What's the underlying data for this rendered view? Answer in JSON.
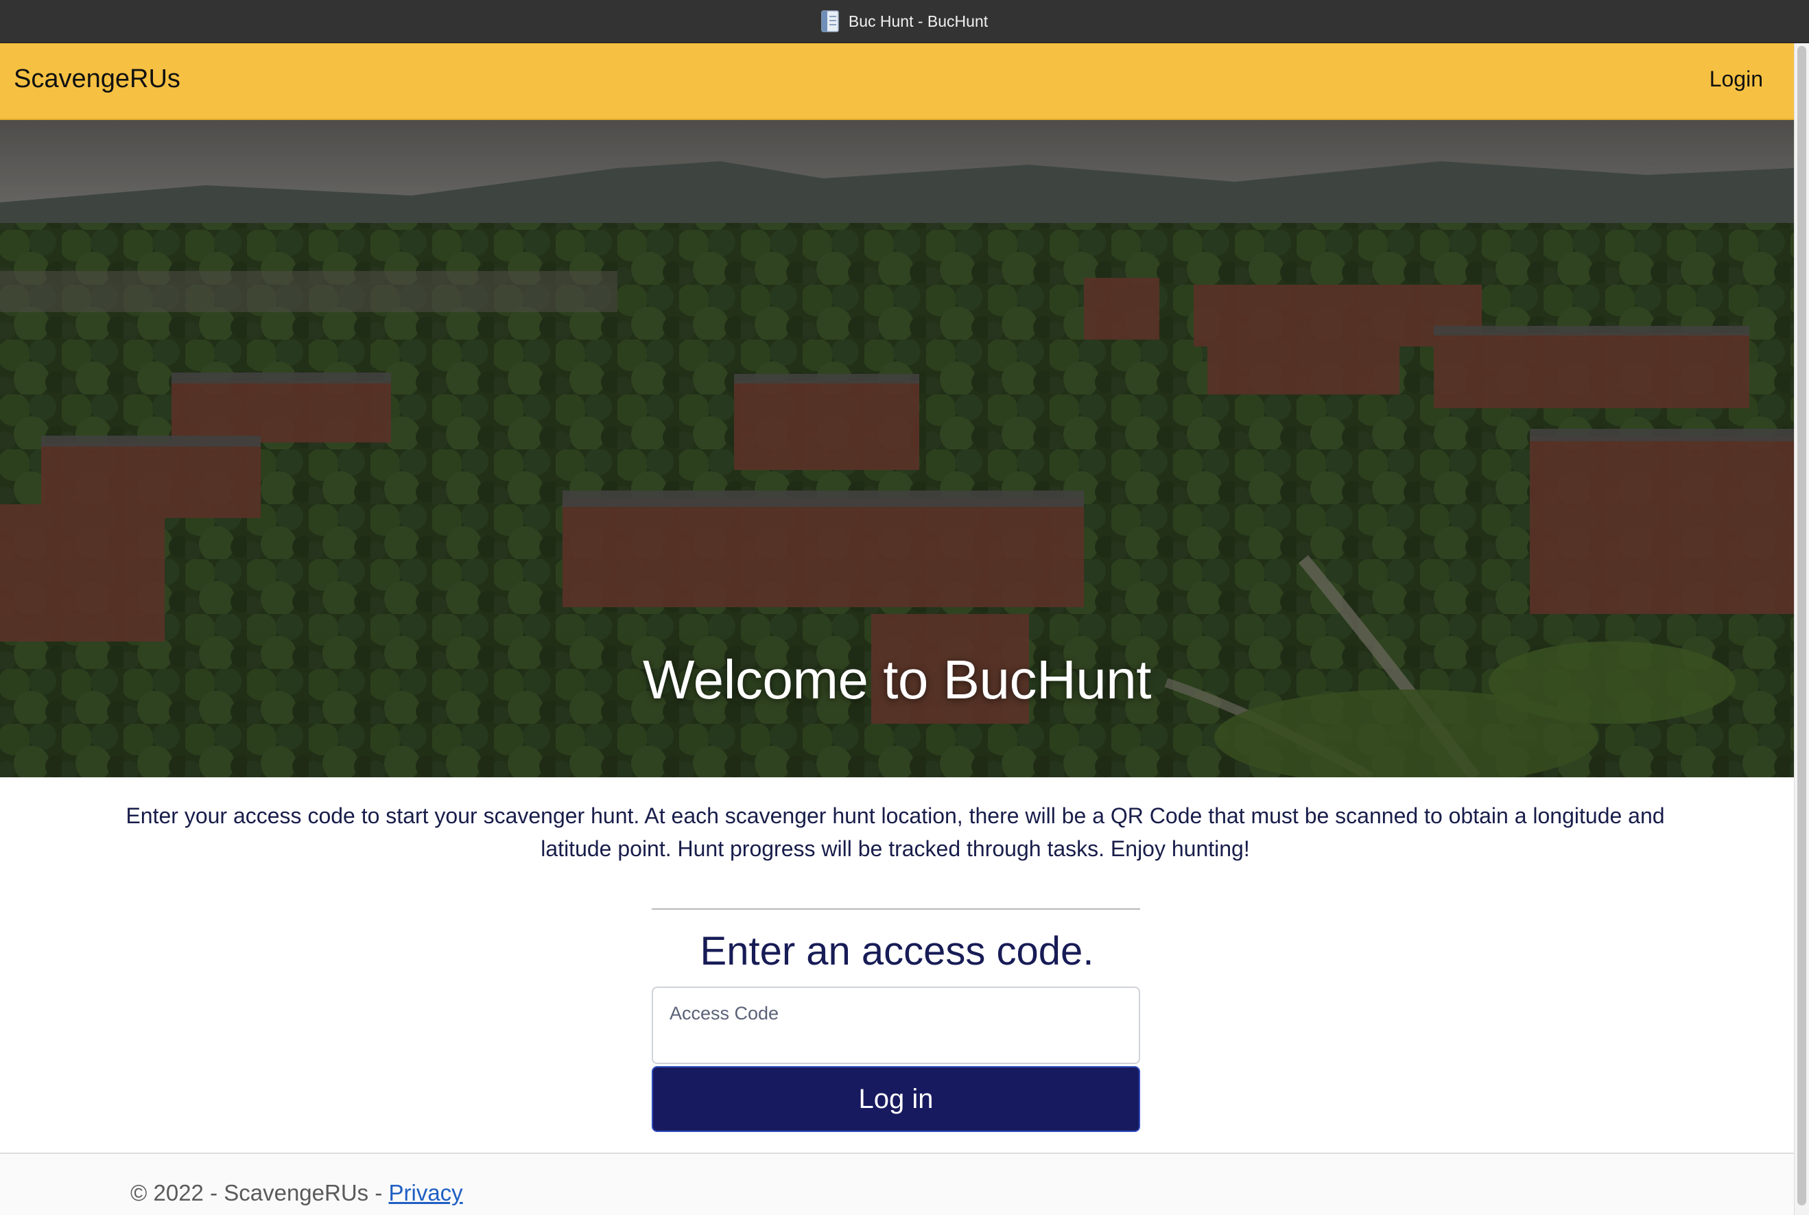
{
  "window": {
    "title": "Buc Hunt - BucHunt",
    "icon": "document-icon"
  },
  "navbar": {
    "brand": "ScavengeRUs",
    "login_link": "Login",
    "background_color": "#f6c142"
  },
  "hero": {
    "title": "Welcome to BucHunt",
    "image_description_icon": "campus-aerial-photo"
  },
  "intro": {
    "text": "Enter your access code to start your scavenger hunt. At each scavenger hunt location, there will be a QR Code that must be scanned to obtain a longitude and latitude point. Hunt progress will be tracked through tasks. Enjoy hunting!"
  },
  "form": {
    "heading": "Enter an access code.",
    "access_code_label": "Access Code",
    "access_code_value": "",
    "submit_label": "Log in",
    "button_color": "#171a5e"
  },
  "footer": {
    "copyright": "© 2022 - ScavengeRUs - ",
    "privacy_link": "Privacy"
  }
}
